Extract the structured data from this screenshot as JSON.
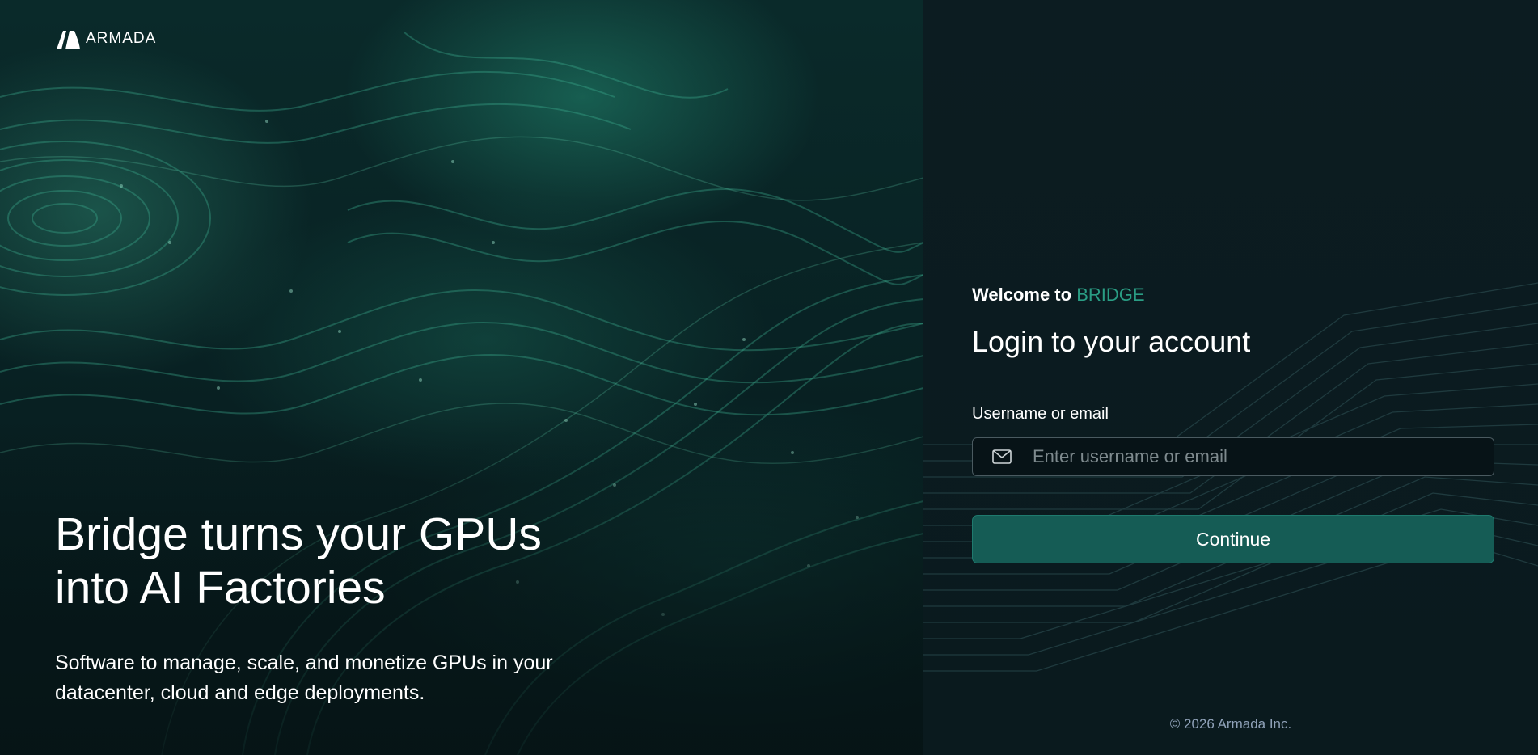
{
  "logo": {
    "text": "ARMADA"
  },
  "hero": {
    "title_line1": "Bridge turns your GPUs",
    "title_line2": "into AI Factories",
    "subtitle_line1": "Software to manage, scale, and monetize GPUs in your",
    "subtitle_line2": "datacenter, cloud and edge deployments."
  },
  "login": {
    "welcome_prefix": "Welcome to ",
    "welcome_brand": "BRIDGE",
    "title": "Login to your account",
    "username_label": "Username or email",
    "username_value": "",
    "username_placeholder": "Enter username or email",
    "continue_label": "Continue"
  },
  "footer": {
    "copyright": "© 2026 Armada Inc."
  },
  "colors": {
    "accent": "#2a9d84",
    "button": "#155c55",
    "background": "#0b1a1f",
    "copyright": "#8fa1b8"
  },
  "icons": {
    "input": "mail-icon",
    "logo": "armada-logo-mark"
  }
}
